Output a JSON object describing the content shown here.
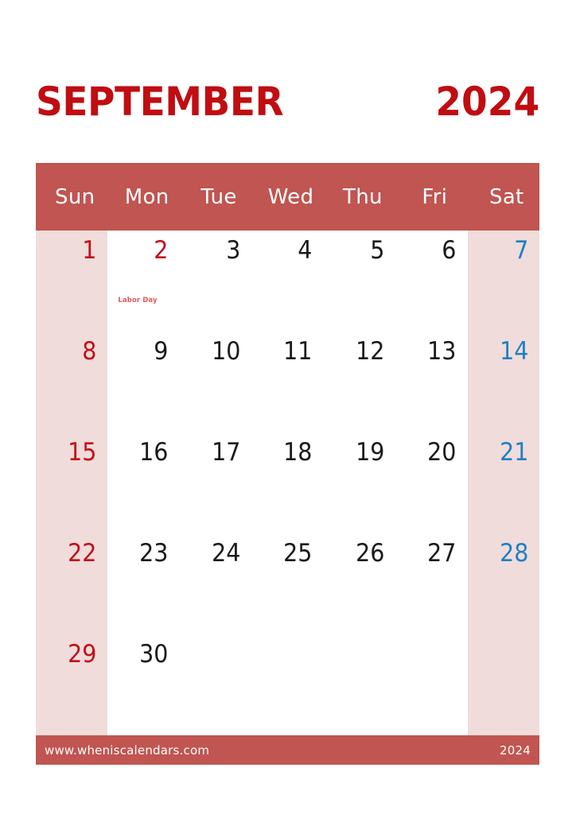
{
  "title": {
    "month": "SEPTEMBER",
    "year": "2024",
    "color": "#C00D12"
  },
  "colors": {
    "header_band": "#C05551",
    "weekend_column": "#F0DCDB",
    "sunday_number": "#C0111A",
    "saturday_number": "#1F7FC4",
    "weekday_number": "#1a1a1a",
    "event_text": "#E2595B",
    "footer_band": "#C05551",
    "page_background": "#FFFFFF"
  },
  "weekdays": [
    {
      "label": "Sun",
      "weekend": true
    },
    {
      "label": "Mon",
      "weekend": false
    },
    {
      "label": "Tue",
      "weekend": false
    },
    {
      "label": "Wed",
      "weekend": false
    },
    {
      "label": "Thu",
      "weekend": false
    },
    {
      "label": "Fri",
      "weekend": false
    },
    {
      "label": "Sat",
      "weekend": true
    }
  ],
  "weeks": [
    [
      {
        "day": "1",
        "kind": "sun",
        "event": ""
      },
      {
        "day": "2",
        "kind": "holiday",
        "event": "Labor Day"
      },
      {
        "day": "3",
        "kind": "weekday",
        "event": ""
      },
      {
        "day": "4",
        "kind": "weekday",
        "event": ""
      },
      {
        "day": "5",
        "kind": "weekday",
        "event": ""
      },
      {
        "day": "6",
        "kind": "weekday",
        "event": ""
      },
      {
        "day": "7",
        "kind": "sat",
        "event": ""
      }
    ],
    [
      {
        "day": "8",
        "kind": "sun",
        "event": ""
      },
      {
        "day": "9",
        "kind": "weekday",
        "event": ""
      },
      {
        "day": "10",
        "kind": "weekday",
        "event": ""
      },
      {
        "day": "11",
        "kind": "weekday",
        "event": ""
      },
      {
        "day": "12",
        "kind": "weekday",
        "event": ""
      },
      {
        "day": "13",
        "kind": "weekday",
        "event": ""
      },
      {
        "day": "14",
        "kind": "sat",
        "event": ""
      }
    ],
    [
      {
        "day": "15",
        "kind": "sun",
        "event": ""
      },
      {
        "day": "16",
        "kind": "weekday",
        "event": ""
      },
      {
        "day": "17",
        "kind": "weekday",
        "event": ""
      },
      {
        "day": "18",
        "kind": "weekday",
        "event": ""
      },
      {
        "day": "19",
        "kind": "weekday",
        "event": ""
      },
      {
        "day": "20",
        "kind": "weekday",
        "event": ""
      },
      {
        "day": "21",
        "kind": "sat",
        "event": ""
      }
    ],
    [
      {
        "day": "22",
        "kind": "sun",
        "event": ""
      },
      {
        "day": "23",
        "kind": "weekday",
        "event": ""
      },
      {
        "day": "24",
        "kind": "weekday",
        "event": ""
      },
      {
        "day": "25",
        "kind": "weekday",
        "event": ""
      },
      {
        "day": "26",
        "kind": "weekday",
        "event": ""
      },
      {
        "day": "27",
        "kind": "weekday",
        "event": ""
      },
      {
        "day": "28",
        "kind": "sat",
        "event": ""
      }
    ],
    [
      {
        "day": "29",
        "kind": "sun",
        "event": ""
      },
      {
        "day": "30",
        "kind": "weekday",
        "event": ""
      },
      {
        "day": "",
        "kind": "empty",
        "event": ""
      },
      {
        "day": "",
        "kind": "empty",
        "event": ""
      },
      {
        "day": "",
        "kind": "empty",
        "event": ""
      },
      {
        "day": "",
        "kind": "empty",
        "event": ""
      },
      {
        "day": "",
        "kind": "empty",
        "event": ""
      }
    ]
  ],
  "footer": {
    "url": "www.wheniscalendars.com",
    "year": "2024"
  }
}
